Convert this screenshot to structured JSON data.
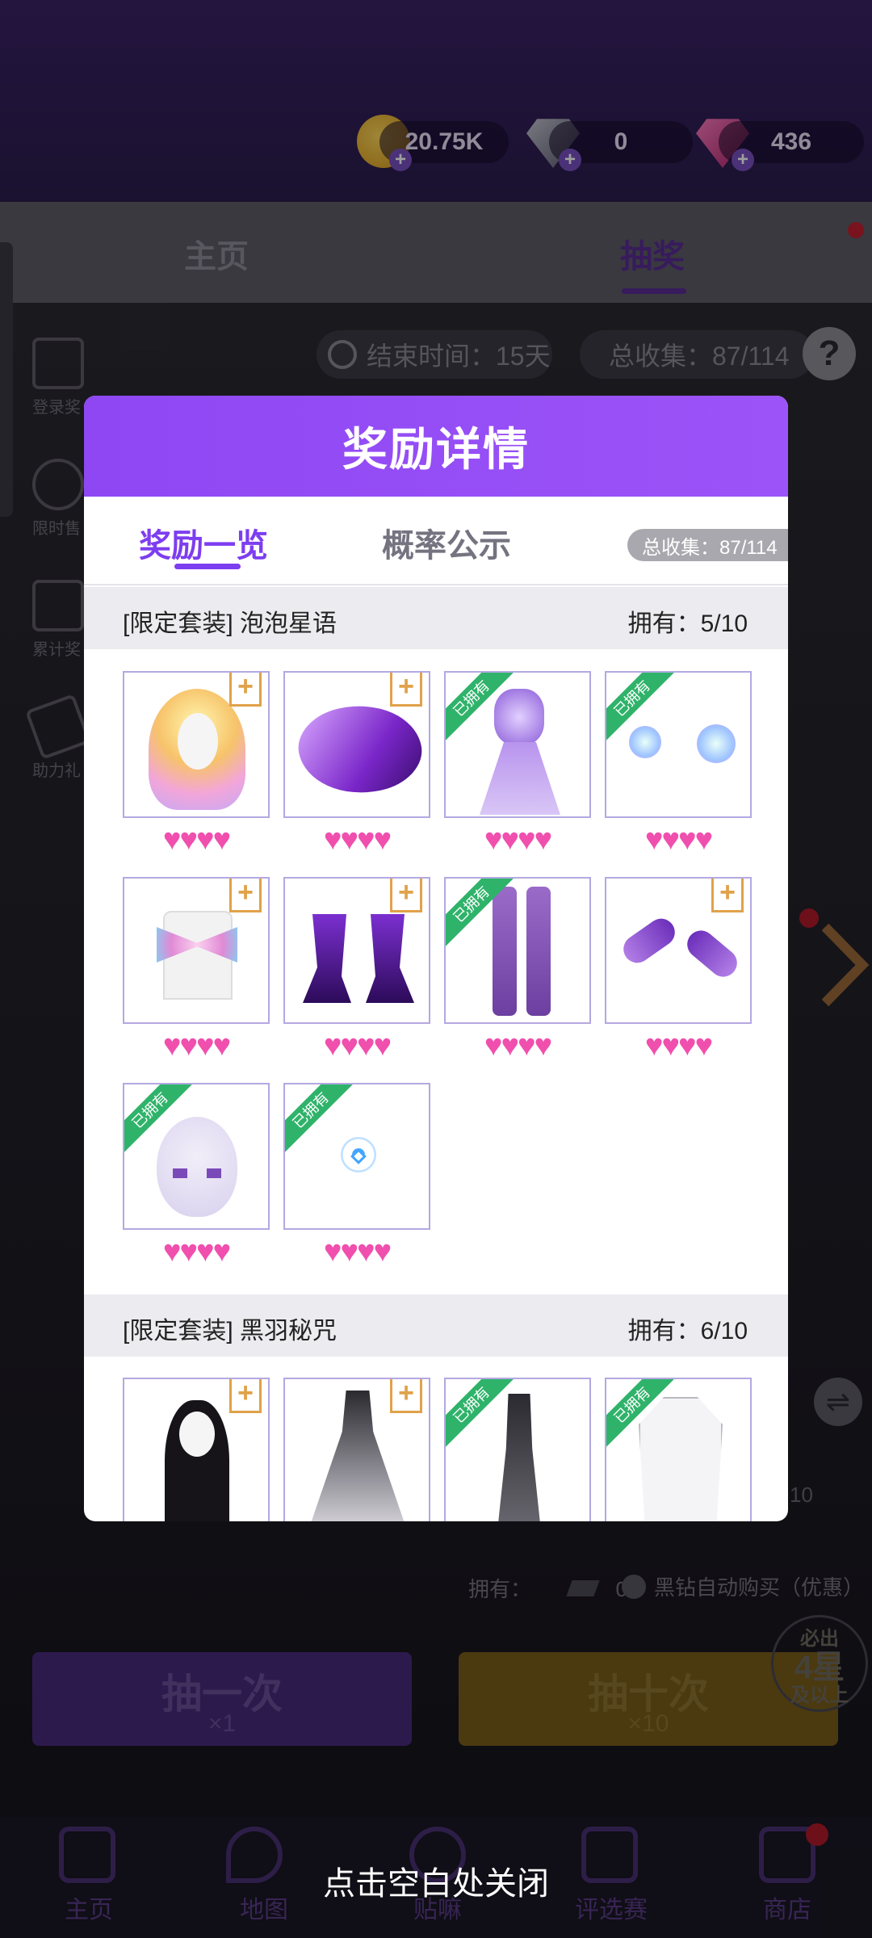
{
  "currencies": [
    {
      "name": "gold-coin",
      "value": "20.75K"
    },
    {
      "name": "diamond",
      "value": "0"
    },
    {
      "name": "pink-gem",
      "value": "436"
    }
  ],
  "tabs": {
    "home": "主页",
    "lottery": "抽奖"
  },
  "info": {
    "end_time": "结束时间：15天",
    "total_collect": "总收集：87/114",
    "help": "?"
  },
  "side_menu": [
    {
      "label": "登录奖"
    },
    {
      "label": "限时售"
    },
    {
      "label": "累计奖"
    },
    {
      "label": "助力礼"
    }
  ],
  "swap_badge": "10",
  "owned_label": "拥有：",
  "owned_count": "0",
  "auto_buy": "黑钻自动购买（优惠）",
  "draw_once": {
    "label": "抽一次",
    "cost": "×1"
  },
  "draw_ten": {
    "label": "抽十次",
    "cost": "×10"
  },
  "guarantee": {
    "line1": "必出",
    "line2": "4星",
    "line3": "及以上"
  },
  "bottom_nav": [
    {
      "label": "主页"
    },
    {
      "label": "地图"
    },
    {
      "label": "贴嘛"
    },
    {
      "label": "评选赛"
    },
    {
      "label": "商店"
    }
  ],
  "close_hint": "点击空白处关闭",
  "modal": {
    "title": "奖励详情",
    "tab_rewards": "奖励一览",
    "tab_rates": "概率公示",
    "collect_chip": "总收集：87/114",
    "sections": [
      {
        "name": "[限定套装] 泡泡星语",
        "owned": "拥有：5/10",
        "items": [
          {
            "type": "hair",
            "owned": false,
            "hearts": "♥♥♥♥"
          },
          {
            "type": "hat",
            "owned": false,
            "hearts": "♥♥♥♥"
          },
          {
            "type": "dress",
            "owned": true,
            "hearts": "♥♥♥♥"
          },
          {
            "type": "earrings",
            "owned": true,
            "hearts": "♥♥♥♥"
          },
          {
            "type": "top",
            "owned": false,
            "hearts": "♥♥♥♥"
          },
          {
            "type": "shoes",
            "owned": false,
            "hearts": "♥♥♥♥"
          },
          {
            "type": "stockings",
            "owned": true,
            "hearts": "♥♥♥♥"
          },
          {
            "type": "gloves",
            "owned": false,
            "hearts": "♥♥♥♥"
          },
          {
            "type": "makeup",
            "owned": true,
            "hearts": "♥♥♥♥"
          },
          {
            "type": "effect",
            "owned": true,
            "hearts": "♥♥♥♥"
          }
        ]
      },
      {
        "name": "[限定套装] 黑羽秘咒",
        "owned": "拥有：6/10",
        "items": [
          {
            "type": "hair",
            "owned": false
          },
          {
            "type": "gown",
            "owned": false
          },
          {
            "type": "dress",
            "owned": true
          },
          {
            "type": "coat",
            "owned": true
          }
        ]
      }
    ],
    "owned_tag": "已拥有",
    "plus_tag": "+"
  }
}
